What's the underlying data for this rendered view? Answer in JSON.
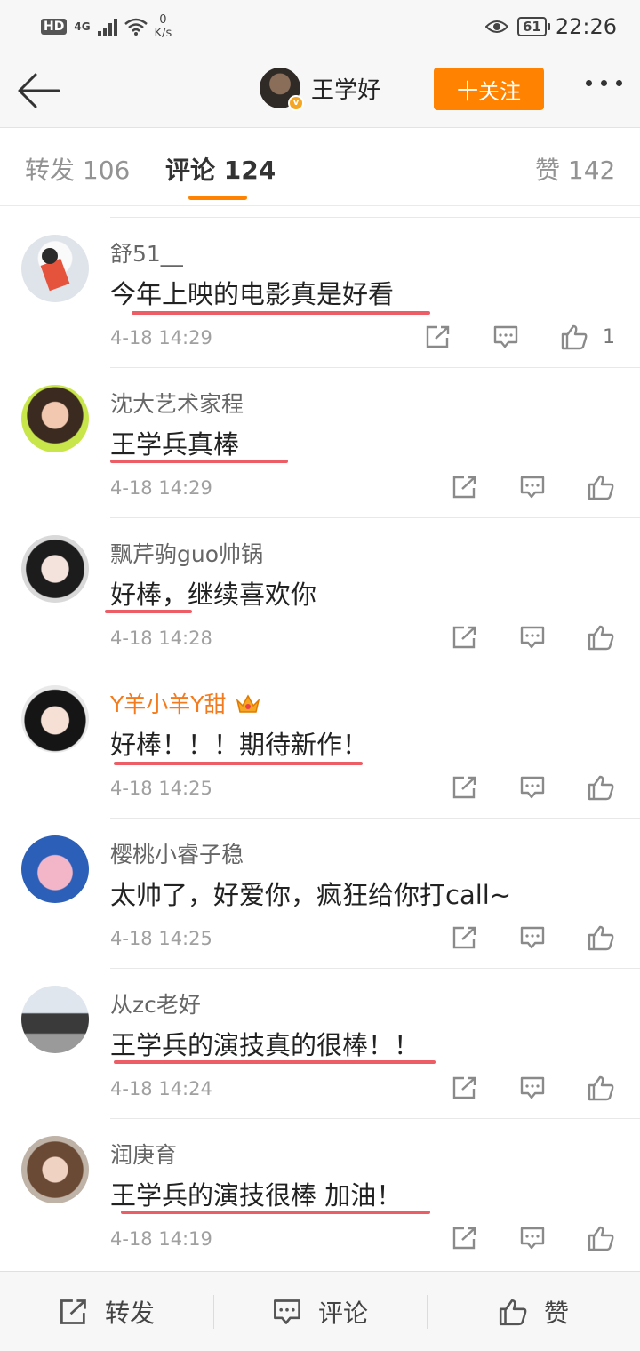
{
  "status_bar": {
    "hd": "HD",
    "network": "4G",
    "speed_value": "0",
    "speed_unit": "K/s",
    "battery": "61",
    "time": "22:26"
  },
  "nav": {
    "username": "王学好",
    "follow_label": "十关注",
    "verify_mark": "v",
    "colors": {
      "follow_button": "#ff8200",
      "verify_badge": "#f5a623"
    }
  },
  "tabs": [
    {
      "label": "转发 106",
      "active": false
    },
    {
      "label": "评论 124",
      "active": true
    },
    {
      "label": "赞 142",
      "active": false
    }
  ],
  "comments": [
    {
      "username": "舒51__",
      "text": "今年上映的电影真是好看",
      "time": "4-18 14:29",
      "likes": "1",
      "vip": false
    },
    {
      "username": "沈大艺术家程",
      "text": "王学兵真棒",
      "time": "4-18 14:29",
      "likes": "",
      "vip": false
    },
    {
      "username": "飘芹驹guo帅锅",
      "text": "好棒，继续喜欢你",
      "time": "4-18 14:28",
      "likes": "",
      "vip": false
    },
    {
      "username": "Y羊小羊Y甜",
      "text": "好棒！！！期待新作！",
      "time": "4-18 14:25",
      "likes": "",
      "vip": true
    },
    {
      "username": "樱桃小睿子稳",
      "text": "太帅了，好爱你，疯狂给你打call~",
      "time": "4-18 14:25",
      "likes": "",
      "vip": false
    },
    {
      "username": "从zc老好",
      "text": "王学兵的演技真的很棒！！",
      "time": "4-18 14:24",
      "likes": "",
      "vip": false
    },
    {
      "username": "润庚育",
      "text": "王学兵的演技很棒 加油！",
      "time": "4-18 14:19",
      "likes": "",
      "vip": false
    }
  ],
  "bottom_bar": {
    "repost_label": "转发",
    "comment_label": "评论",
    "like_label": "赞"
  },
  "icons": {
    "back": "back-arrow-icon",
    "more": "more-dots-icon",
    "repost": "repost-icon",
    "comment": "comment-icon",
    "like": "thumbs-up-icon",
    "crown": "crown-icon"
  }
}
